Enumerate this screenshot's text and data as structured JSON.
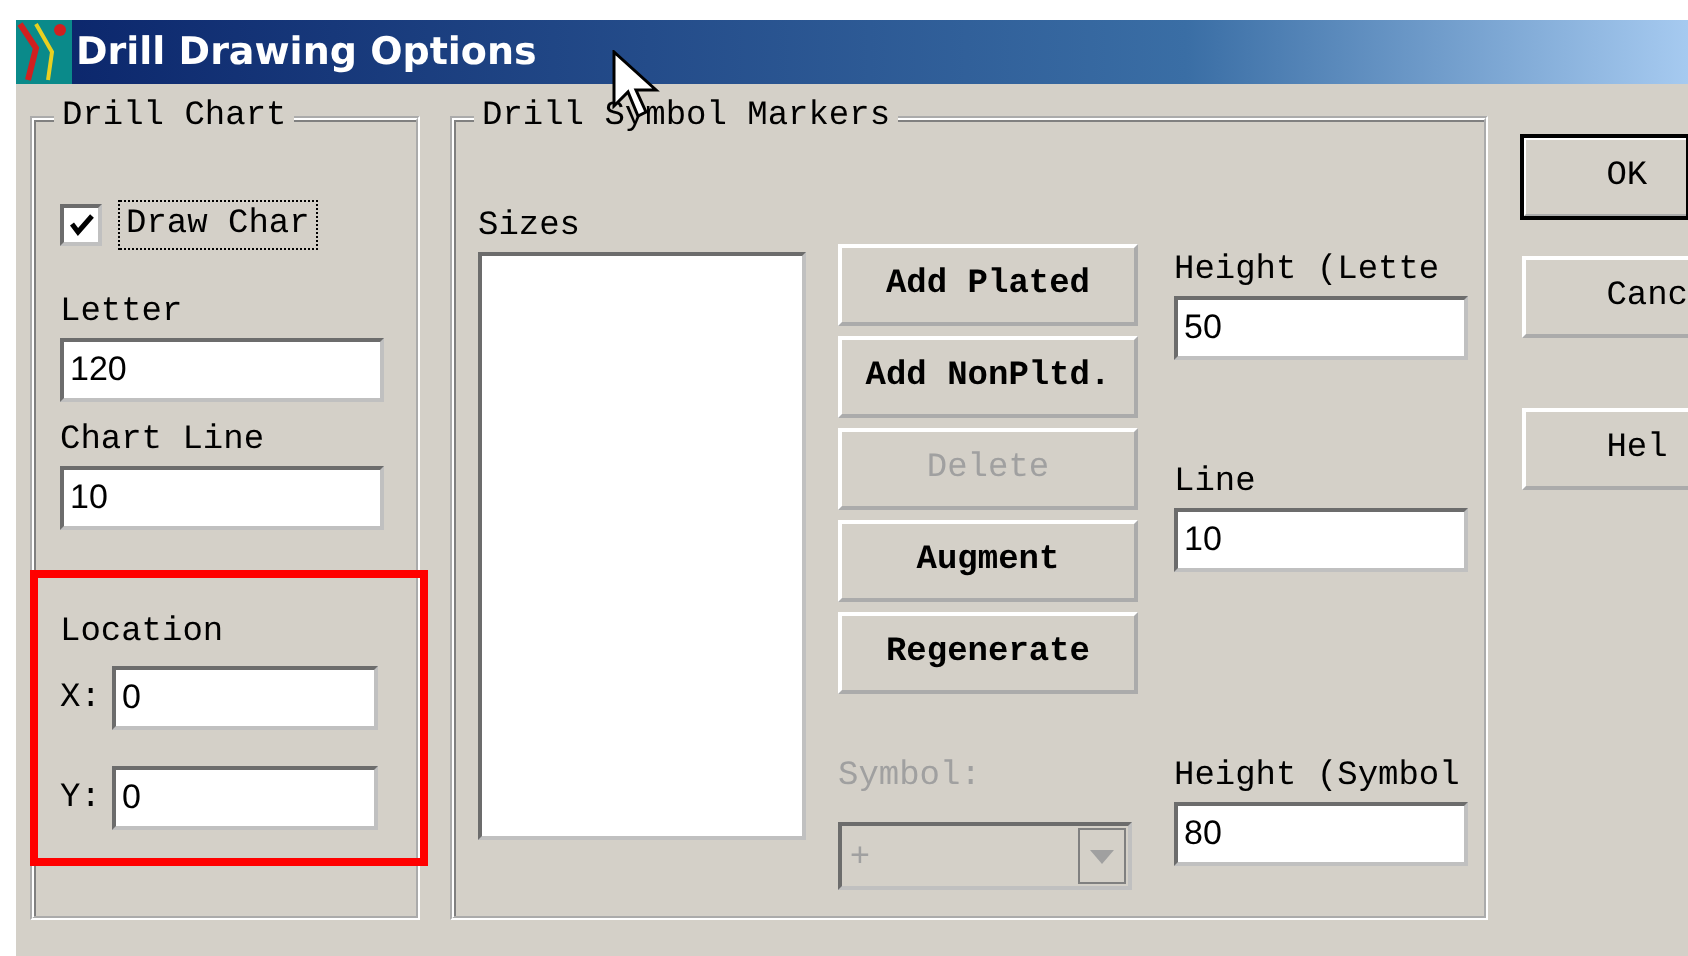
{
  "window": {
    "title": "Drill Drawing Options"
  },
  "drill_chart": {
    "title": "Drill Chart",
    "draw_chart": {
      "label": "Draw Char",
      "checked": true,
      "focused": true
    },
    "letter": {
      "label": "Letter",
      "value": "120"
    },
    "chart_line": {
      "label": "Chart Line",
      "value": "10"
    },
    "location": {
      "label": "Location",
      "highlighted": true,
      "x": {
        "label": "X:",
        "value": "0"
      },
      "y": {
        "label": "Y:",
        "value": "0"
      }
    }
  },
  "drill_symbol_markers": {
    "title": "Drill Symbol Markers",
    "sizes": {
      "label": "Sizes"
    },
    "buttons": [
      {
        "label": "Add Plated",
        "disabled": false
      },
      {
        "label": "Add NonPltd.",
        "disabled": false
      },
      {
        "label": "Delete",
        "disabled": true
      },
      {
        "label": "Augment",
        "disabled": false
      },
      {
        "label": "Regenerate",
        "disabled": false
      }
    ],
    "symbol": {
      "label": "Symbol:",
      "value": "+",
      "disabled": true
    },
    "fields": [
      {
        "label": "Height (Lette",
        "value": "50"
      },
      {
        "label": "Line",
        "value": "10"
      },
      {
        "label": "Height (Symbol",
        "value": "80"
      }
    ]
  },
  "dialog_buttons": [
    {
      "label": "OK",
      "default": true
    },
    {
      "label": "Canc",
      "default": false
    },
    {
      "label": "Hel",
      "default": false
    }
  ]
}
